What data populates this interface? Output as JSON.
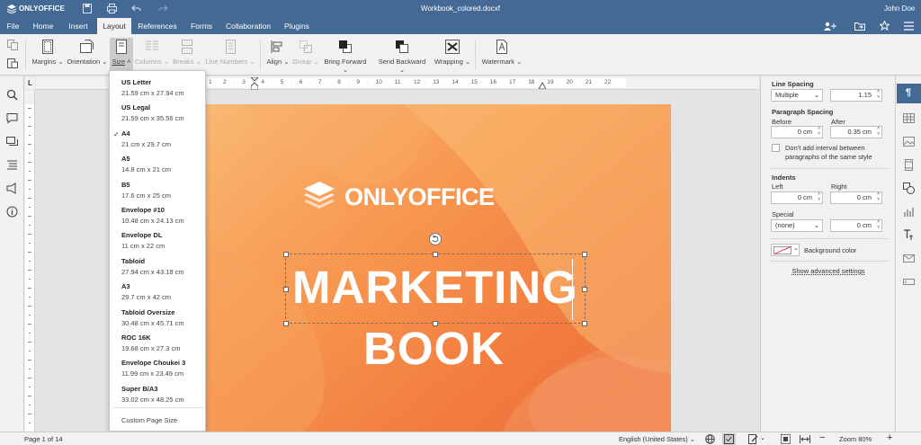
{
  "app": {
    "logo": "ONLYOFFICE",
    "doc_title": "Workbook_colored.docxf",
    "user": "John Doe"
  },
  "tabs": [
    "File",
    "Home",
    "Insert",
    "Layout",
    "References",
    "Forms",
    "Collaboration",
    "Plugins"
  ],
  "toolbar": {
    "margins": "Margins",
    "orientation": "Orientation",
    "size": "Size",
    "columns": "Columns",
    "breaks": "Breaks",
    "line_numbers": "Line Numbers",
    "align": "Align",
    "group": "Group",
    "bring_forward": "Bring Forward",
    "send_backward": "Send Backward",
    "wrapping": "Wrapping",
    "watermark": "Watermark"
  },
  "ruler": {
    "h_left": "1",
    "h_ticks": [
      "2",
      "3",
      "4",
      "5",
      "6",
      "7",
      "8",
      "9",
      "10",
      "11",
      "12",
      "13",
      "14",
      "15",
      "16",
      "17",
      "18",
      "19",
      "20",
      "21",
      "22"
    ]
  },
  "size_menu": {
    "items": [
      {
        "name": "US Letter",
        "dims": "21.59 cm x 27.94 cm",
        "checked": false
      },
      {
        "name": "US Legal",
        "dims": "21.59 cm x 35.56 cm",
        "checked": false
      },
      {
        "name": "A4",
        "dims": "21 cm x 29.7 cm",
        "checked": true
      },
      {
        "name": "A5",
        "dims": "14.8 cm x 21 cm",
        "checked": false
      },
      {
        "name": "B5",
        "dims": "17.6 cm x 25 cm",
        "checked": false
      },
      {
        "name": "Envelope #10",
        "dims": "10.48 cm x 24.13 cm",
        "checked": false
      },
      {
        "name": "Envelope DL",
        "dims": "11 cm x 22 cm",
        "checked": false
      },
      {
        "name": "Tabloid",
        "dims": "27.94 cm x 43.18 cm",
        "checked": false
      },
      {
        "name": "A3",
        "dims": "29.7 cm x 42 cm",
        "checked": false
      },
      {
        "name": "Tabloid Oversize",
        "dims": "30.48 cm x 45.71 cm",
        "checked": false
      },
      {
        "name": "ROC 16K",
        "dims": "19.68 cm x 27.3 cm",
        "checked": false
      },
      {
        "name": "Envelope Choukei 3",
        "dims": "11.99 cm x 23.49 cm",
        "checked": false
      },
      {
        "name": "Super B/A3",
        "dims": "33.02 cm x 48.25 cm",
        "checked": false
      }
    ],
    "custom": "Custom Page Size",
    "check_mark": "✓"
  },
  "page": {
    "logo_text": "ONLYOFFICE",
    "line1": "MARKETING",
    "line2": "BOOK"
  },
  "right_panel": {
    "line_spacing_title": "Line Spacing",
    "line_spacing_mode": "Multiple",
    "line_spacing_value": "1.15",
    "para_spacing_title": "Paragraph Spacing",
    "before_label": "Before",
    "after_label": "After",
    "before_value": "0 cm",
    "after_value": "0.35 cm",
    "dont_add_interval": "Don't add interval between paragraphs of the same style",
    "indents_title": "Indents",
    "left_label": "Left",
    "right_label": "Right",
    "left_value": "0 cm",
    "right_value": "0 cm",
    "special_label": "Special",
    "special_mode": "(none)",
    "special_value": "0 cm",
    "background_color": "Background color",
    "advanced": "Show advanced settings"
  },
  "status": {
    "page": "Page 1 of 14",
    "language": "English (United States)",
    "zoom": "Zoom 80%"
  },
  "colors": {
    "brand": "#446995",
    "accent_orange": "#f27d3f"
  }
}
